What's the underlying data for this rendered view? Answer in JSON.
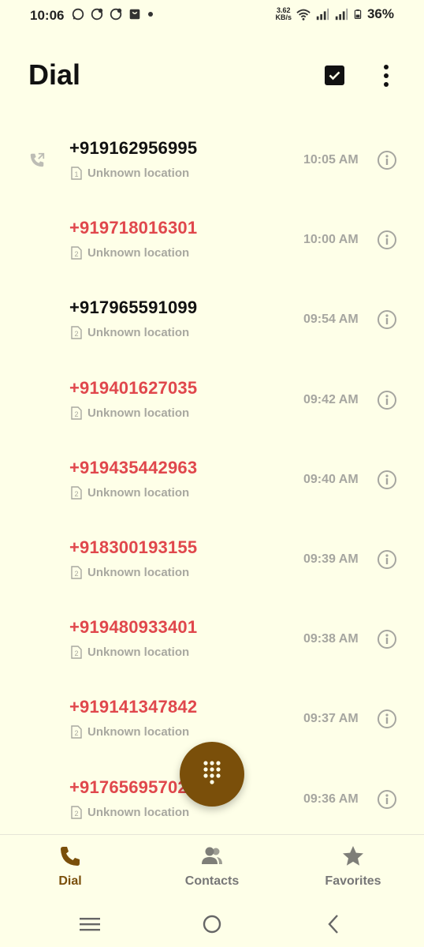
{
  "status_bar": {
    "time": "10:06",
    "net_speed_value": "3.62",
    "net_speed_unit": "KB/s",
    "battery": "36%"
  },
  "header": {
    "title": "Dial"
  },
  "calls": [
    {
      "number": "+919162956995",
      "location": "Unknown location",
      "sim": "1",
      "time": "10:05 AM",
      "missed": false,
      "outgoing": true
    },
    {
      "number": "+919718016301",
      "location": "Unknown location",
      "sim": "2",
      "time": "10:00 AM",
      "missed": true,
      "outgoing": false
    },
    {
      "number": "+917965591099",
      "location": "Unknown location",
      "sim": "2",
      "time": "09:54 AM",
      "missed": false,
      "outgoing": false
    },
    {
      "number": "+919401627035",
      "location": "Unknown location",
      "sim": "2",
      "time": "09:42 AM",
      "missed": true,
      "outgoing": false
    },
    {
      "number": "+919435442963",
      "location": "Unknown location",
      "sim": "2",
      "time": "09:40 AM",
      "missed": true,
      "outgoing": false
    },
    {
      "number": "+918300193155",
      "location": "Unknown location",
      "sim": "2",
      "time": "09:39 AM",
      "missed": true,
      "outgoing": false
    },
    {
      "number": "+919480933401",
      "location": "Unknown location",
      "sim": "2",
      "time": "09:38 AM",
      "missed": true,
      "outgoing": false
    },
    {
      "number": "+919141347842",
      "location": "Unknown location",
      "sim": "2",
      "time": "09:37 AM",
      "missed": true,
      "outgoing": false
    },
    {
      "number": "+91765695702",
      "location": "Unknown location",
      "sim": "2",
      "time": "09:36 AM",
      "missed": true,
      "outgoing": false
    }
  ],
  "bottom_nav": {
    "dial_label": "Dial",
    "contacts_label": "Contacts",
    "favorites_label": "Favorites"
  },
  "colors": {
    "background": "#FEFFE8",
    "accent": "#7A4F0A",
    "missed": "#E0474C",
    "muted": "#A6A6A0"
  }
}
